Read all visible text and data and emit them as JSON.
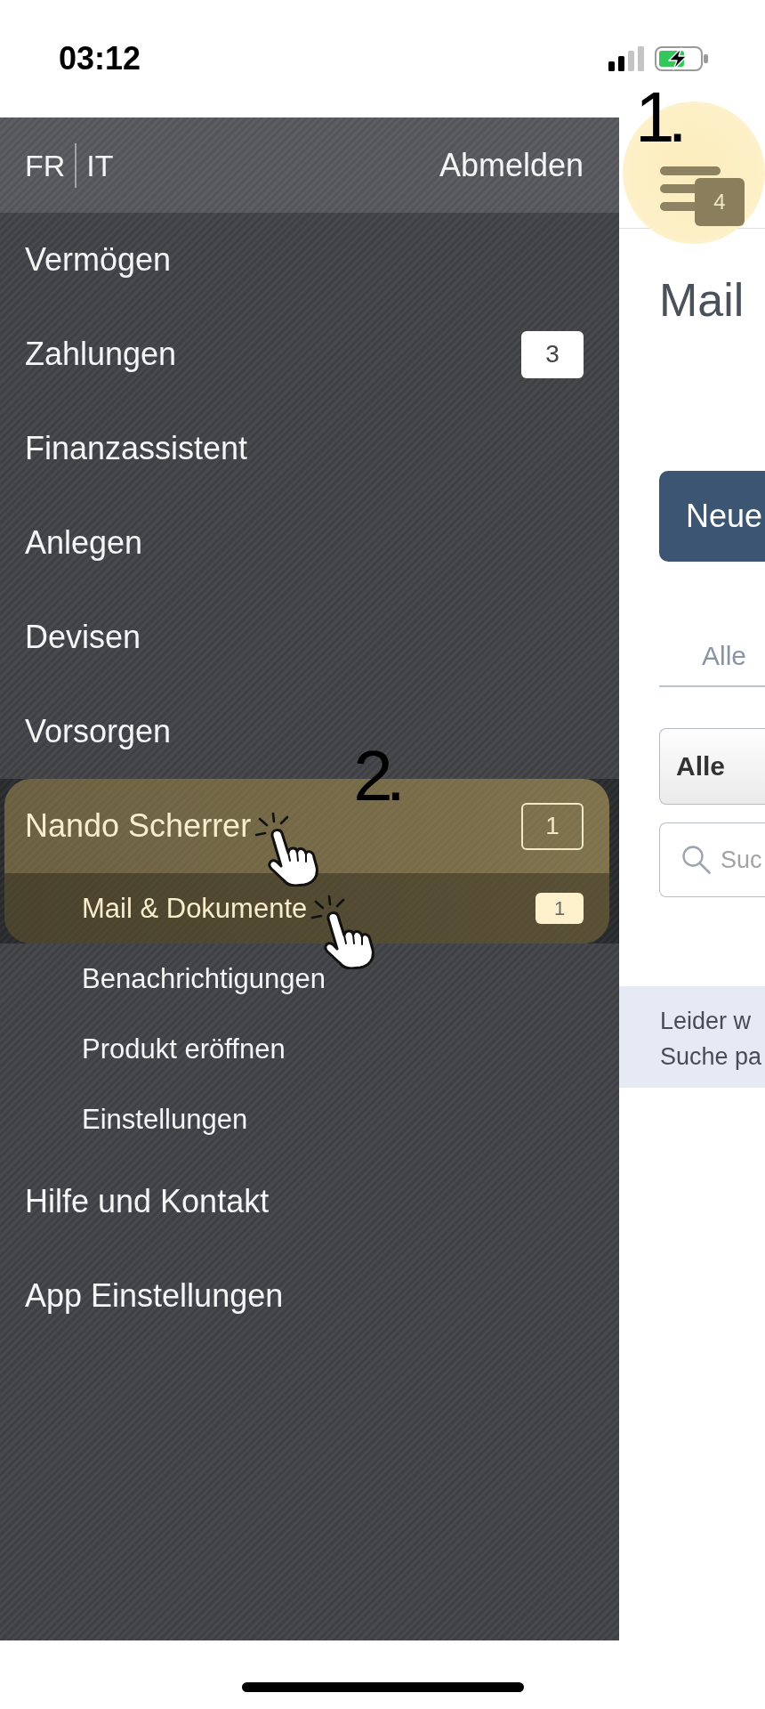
{
  "status_bar": {
    "time": "03:12"
  },
  "drawer": {
    "languages": [
      {
        "label": "FR"
      },
      {
        "label": "IT"
      }
    ],
    "logout": "Abmelden",
    "items": [
      {
        "label": "Vermögen",
        "selected": false,
        "highlighted": false,
        "tapped": false
      },
      {
        "label": "Zahlungen",
        "badge": {
          "text": "3",
          "kind": "solid"
        },
        "selected": false,
        "highlighted": false,
        "tapped": false
      },
      {
        "label": "Finanzassistent",
        "selected": false,
        "highlighted": false,
        "tapped": false
      },
      {
        "label": "Anlegen",
        "selected": false,
        "highlighted": false,
        "tapped": false
      },
      {
        "label": "Devisen",
        "selected": false,
        "highlighted": false,
        "tapped": false
      },
      {
        "label": "Vorsorgen",
        "selected": false,
        "highlighted": false,
        "tapped": false
      },
      {
        "label": "Nando Scherrer",
        "badge": {
          "text": "1",
          "kind": "outline"
        },
        "selected": false,
        "highlighted": true,
        "tapped": true,
        "step": "2.",
        "children": [
          {
            "label": "Mail & Dokumente",
            "badge": {
              "text": "1",
              "kind": "solid"
            },
            "selected": true,
            "highlighted": true,
            "tapped": true
          },
          {
            "label": "Benachrichtigungen",
            "selected": false,
            "highlighted": false,
            "tapped": false
          },
          {
            "label": "Produkt eröffnen",
            "selected": false,
            "highlighted": false,
            "tapped": false
          },
          {
            "label": "Einstellungen",
            "selected": false,
            "highlighted": false,
            "tapped": false
          }
        ]
      },
      {
        "label": "Hilfe und Kontakt",
        "selected": false,
        "highlighted": false,
        "tapped": false
      },
      {
        "label": "App Einstellungen",
        "selected": false,
        "highlighted": false,
        "tapped": false
      }
    ]
  },
  "menu_button": {
    "badge": "4",
    "step": "1.",
    "highlighted": true
  },
  "page": {
    "title": "Mail",
    "new_button": "Neue",
    "tabs": [
      {
        "label": "Alle",
        "selected": false
      }
    ],
    "filter": {
      "value": "Alle"
    },
    "search": {
      "placeholder": "Suc"
    },
    "notice": {
      "lines": [
        "Leider w",
        "Suche pa"
      ]
    }
  }
}
